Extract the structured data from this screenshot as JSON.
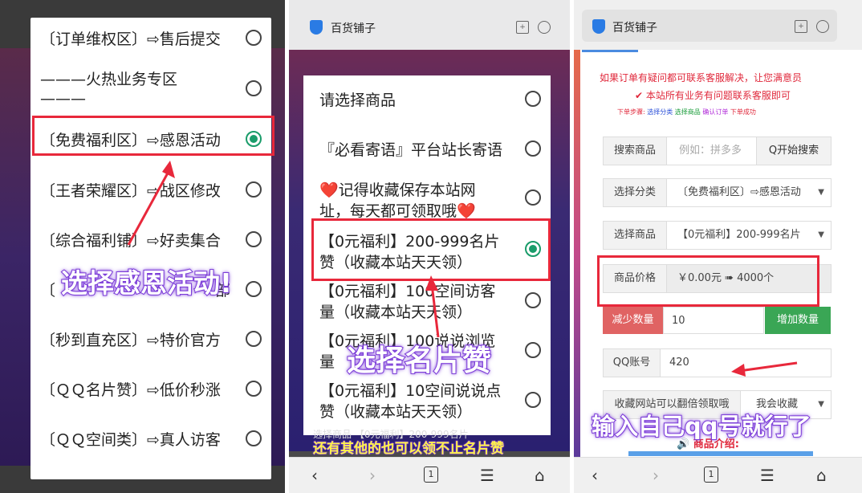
{
  "panel1": {
    "options": [
      {
        "label": "〔订单维权区〕⇨售后提交",
        "selected": false
      },
      {
        "label": "———火热业务专区",
        "label2": "———",
        "selected": false
      },
      {
        "label": "〔免费福利区〕⇨感恩活动",
        "selected": true
      },
      {
        "label": "〔王者荣耀区〕⇨战区修改",
        "selected": false
      },
      {
        "label": "〔综合福利铺〕⇨好卖集合",
        "selected": false
      },
      {
        "label": "〔",
        "tail": "部",
        "selected": false
      },
      {
        "label": "〔秒到直充区〕⇨特价官方",
        "selected": false
      },
      {
        "label": "〔ＱＱ名片赞〕⇨低价秒涨",
        "selected": false
      },
      {
        "label": "〔ＱＱ空间类〕⇨真人访客",
        "selected": false
      }
    ],
    "caption": "选择感恩活动!"
  },
  "panel2": {
    "site_title": "百货铺子",
    "options": [
      {
        "label": "请选择商品",
        "selected": false
      },
      {
        "label": "『必看寄语』平台站长寄语",
        "selected": false
      },
      {
        "label": "❤️记得收藏保存本站网",
        "label2": "址，每天都可领取哦❤️",
        "selected": false
      },
      {
        "label": "【0元福利】200-999名片",
        "label2": "赞（收藏本站天天领）",
        "selected": true
      },
      {
        "label": "【0元福利】100空间访客",
        "label2": "量（收藏本站天天领）",
        "selected": false
      },
      {
        "label": "【0元福利】100说说浏览",
        "label2": "量",
        "selected": false
      },
      {
        "label": "【0元福利】10空间说说点",
        "label2": "赞（收藏本站天天领）",
        "selected": false
      }
    ],
    "caption": "选择名片赞",
    "bottom_partial": "选择商品    【0元福利】200-999名片",
    "note": "还有其他的也可以领不止名片赞",
    "tab_count": "1"
  },
  "panel3": {
    "site_title": "百货铺子",
    "notice1": "如果订单有疑问都可联系客服解决，让您满意员",
    "notice2": "✔ 本站所有业务有问题联系客服即可",
    "steps": {
      "prefix": "下单步骤:",
      "s1": "选择分类",
      "s2": "选择商品",
      "s3": "确认订单",
      "s4": "下单成功"
    },
    "search": {
      "label": "搜索商品",
      "placeholder": "例如：拼多多",
      "button": "Q开始搜索"
    },
    "category": {
      "label": "选择分类",
      "value": "〔免费福利区〕⇨感恩活动"
    },
    "product": {
      "label": "选择商品",
      "value": "【0元福利】200-999名片"
    },
    "price": {
      "label": "商品价格",
      "value": "￥0.00元 ➠ 4000个"
    },
    "qty": {
      "minus": "减少数量",
      "value": "10",
      "plus": "增加数量"
    },
    "qq": {
      "label": "QQ账号",
      "value": "420"
    },
    "collect": {
      "label": "收藏网站可以翻倍领取哦",
      "value": "我会收藏"
    },
    "intro": "🔊 商品介绍:",
    "caption": "输入自己qq号就行了",
    "tab_count": "1"
  }
}
